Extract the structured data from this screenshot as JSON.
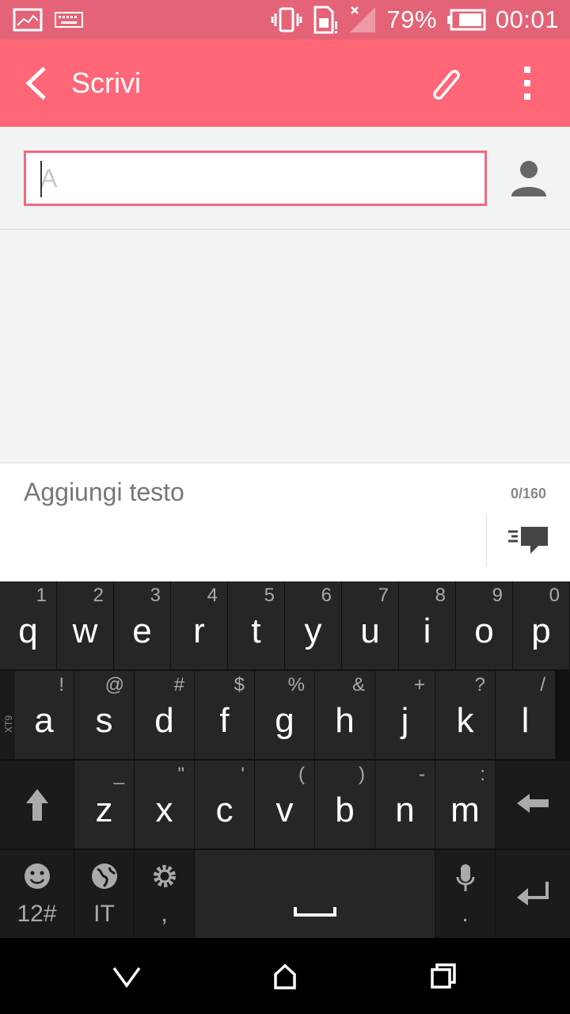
{
  "status": {
    "battery_percent": "79%",
    "time": "00:01",
    "icons": [
      "image-icon",
      "keyboard-icon",
      "vibrate-icon",
      "sim-icon",
      "signal-icon",
      "battery-icon"
    ]
  },
  "appbar": {
    "title": "Scrivi",
    "icons": [
      "back-icon",
      "attach-icon",
      "more-icon"
    ]
  },
  "recipient": {
    "placeholder": "A",
    "value": ""
  },
  "compose": {
    "placeholder": "Aggiungi testo",
    "counter": "0/160"
  },
  "keyboard": {
    "row1": [
      {
        "key": "q",
        "sub": "1"
      },
      {
        "key": "w",
        "sub": "2"
      },
      {
        "key": "e",
        "sub": "3"
      },
      {
        "key": "r",
        "sub": "4"
      },
      {
        "key": "t",
        "sub": "5"
      },
      {
        "key": "y",
        "sub": "6"
      },
      {
        "key": "u",
        "sub": "7"
      },
      {
        "key": "i",
        "sub": "8"
      },
      {
        "key": "o",
        "sub": "9"
      },
      {
        "key": "p",
        "sub": "0"
      }
    ],
    "row2": [
      {
        "key": "a",
        "sub": "!"
      },
      {
        "key": "s",
        "sub": "@"
      },
      {
        "key": "d",
        "sub": "#"
      },
      {
        "key": "f",
        "sub": "$"
      },
      {
        "key": "g",
        "sub": "%"
      },
      {
        "key": "h",
        "sub": "&"
      },
      {
        "key": "j",
        "sub": "+"
      },
      {
        "key": "k",
        "sub": "?"
      },
      {
        "key": "l",
        "sub": "/"
      }
    ],
    "row2_side_label": "XT9",
    "row3": [
      {
        "key": "z",
        "sub": "_"
      },
      {
        "key": "x",
        "sub": "\""
      },
      {
        "key": "c",
        "sub": "'"
      },
      {
        "key": "v",
        "sub": "("
      },
      {
        "key": "b",
        "sub": ")"
      },
      {
        "key": "n",
        "sub": "-"
      },
      {
        "key": "m",
        "sub": ":"
      }
    ],
    "symbols_label": "12#",
    "language_label": "IT",
    "comma_label": ",",
    "period_label": "."
  }
}
